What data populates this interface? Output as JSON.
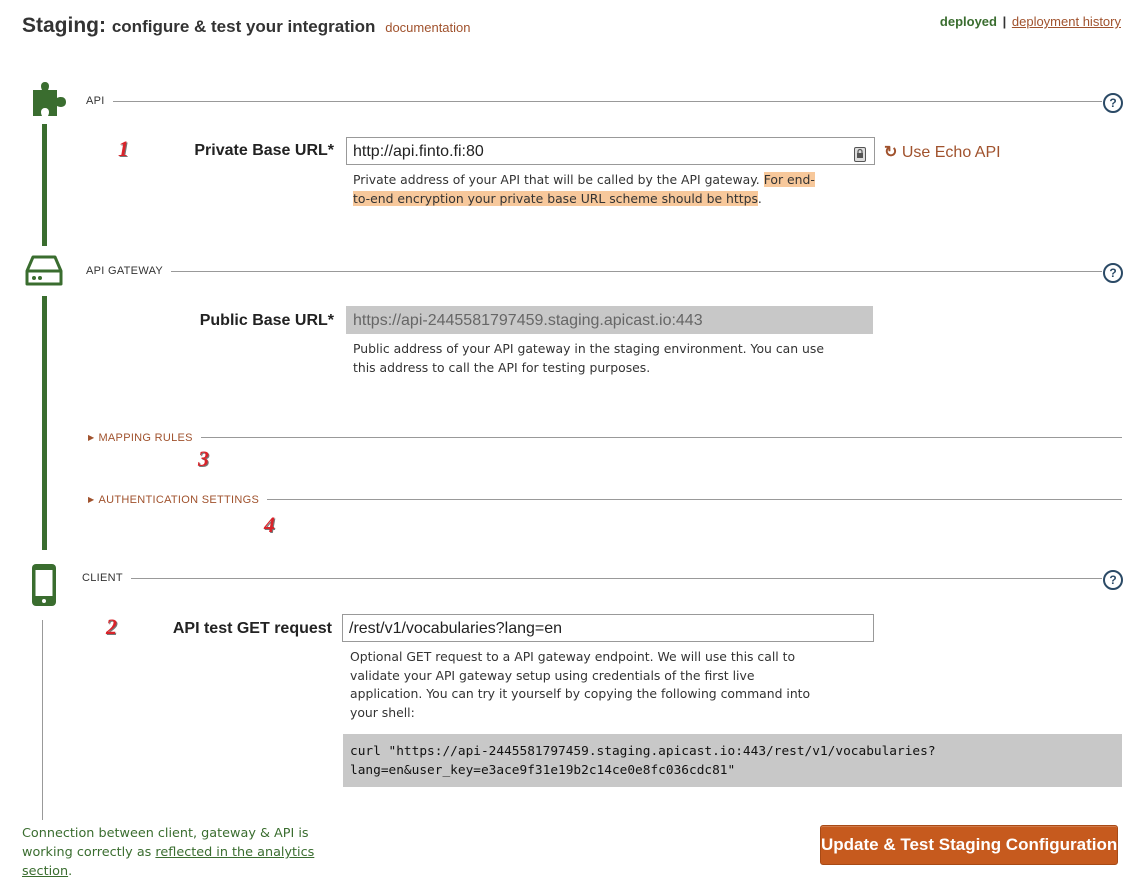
{
  "header": {
    "title_main": "Staging:",
    "title_sub": "configure & test your integration",
    "documentation_link": "documentation",
    "status": "deployed",
    "separator": "|",
    "history_link": "deployment history"
  },
  "sections": {
    "api": {
      "label": "API",
      "icon": "puzzle-piece-icon",
      "help": "?"
    },
    "gateway": {
      "label": "API GATEWAY",
      "icon": "server-drive-icon",
      "help": "?"
    },
    "client": {
      "label": "CLIENT",
      "icon": "mobile-phone-icon",
      "help": "?"
    }
  },
  "private_base_url": {
    "step": "1",
    "label": "Private Base URL*",
    "value": "http://api.finto.fi:80",
    "help_text": "Private address of your API that will be called by the API gateway.",
    "help_highlight_1": "For end-",
    "help_highlight_2": "to-end encryption your private base URL scheme should be https",
    "help_end": ".",
    "echo_icon": "undo-icon",
    "echo_label": "Use Echo API"
  },
  "public_base_url": {
    "label": "Public Base URL*",
    "value": "https://api-2445581797459.staging.apicast.io:443",
    "help_line1": "Public address of your API gateway in the staging environment. You can use",
    "help_line2": "this address to call the API for testing purposes."
  },
  "mapping_rules": {
    "label": "MAPPING RULES",
    "step": "3"
  },
  "auth_settings": {
    "label": "AUTHENTICATION SETTINGS",
    "step": "4"
  },
  "test_request": {
    "step": "2",
    "label": "API test GET request",
    "value": "/rest/v1/vocabularies?lang=en",
    "help_line1": "Optional GET request to a API gateway endpoint. We will use this call to",
    "help_line2": "validate your API gateway setup using credentials of the first live",
    "help_line3": "application. You can try it yourself by copying the following command into",
    "help_line4": "your shell:",
    "curl_line1": "curl \"https://api-2445581797459.staging.apicast.io:443/rest/v1/vocabularies?",
    "curl_line2": "lang=en&user_key=e3ace9f31e19b2c14ce0e8fc036cdc81\""
  },
  "footer": {
    "note_line1": "Connection between client, gateway & API is",
    "note_line2_pre": "working correctly as ",
    "note_link_1": "reflected in the analytics",
    "note_link_2": "section",
    "note_end": ".",
    "button_label": "Update & Test Staging Configuration"
  },
  "colors": {
    "accent_green": "#3a6d2f",
    "link_brown": "#a0522d",
    "button_orange": "#c65a1e",
    "step_red": "#d9232a"
  }
}
